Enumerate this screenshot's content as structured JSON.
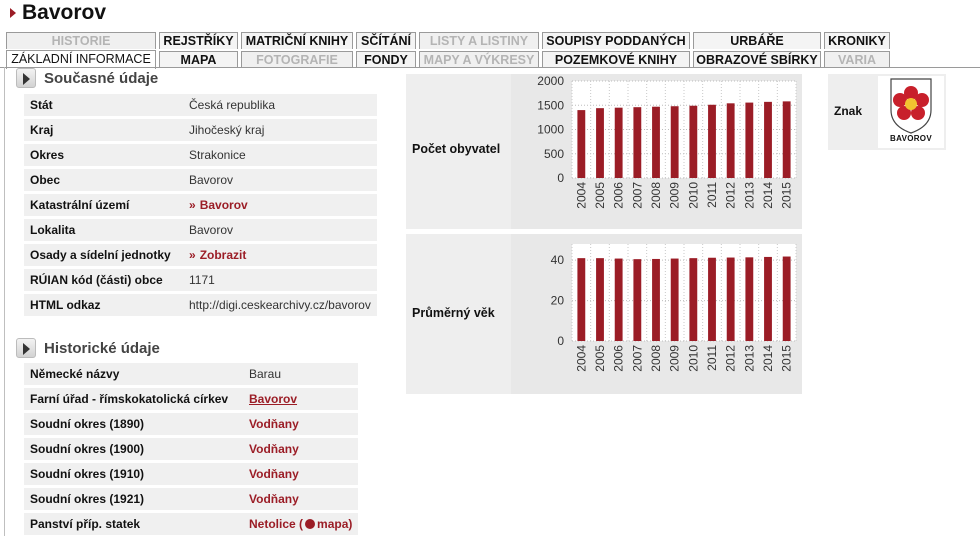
{
  "page": {
    "title": "Bavorov"
  },
  "tabs": {
    "row1": [
      {
        "label": "HISTORIE",
        "disabled": true
      },
      {
        "label": "REJSTŘÍKY",
        "disabled": false
      },
      {
        "label": "MATRIČNÍ KNIHY",
        "disabled": false
      },
      {
        "label": "SČÍTÁNÍ",
        "disabled": false
      },
      {
        "label": "LISTY A LISTINY",
        "disabled": true
      },
      {
        "label": "SOUPISY PODDANÝCH",
        "disabled": false
      },
      {
        "label": "URBÁŘE",
        "disabled": false
      },
      {
        "label": "KRONIKY",
        "disabled": false
      }
    ],
    "row2": [
      {
        "label": "ZÁKLADNÍ INFORMACE",
        "active": true
      },
      {
        "label": "MAPA",
        "disabled": false
      },
      {
        "label": "FOTOGRAFIE",
        "disabled": true
      },
      {
        "label": "FONDY",
        "disabled": false
      },
      {
        "label": "MAPY A VÝKRESY",
        "disabled": true
      },
      {
        "label": "POZEMKOVÉ KNIHY",
        "disabled": false
      },
      {
        "label": "OBRAZOVÉ SBÍRKY",
        "disabled": false
      },
      {
        "label": "VARIA",
        "disabled": true
      }
    ]
  },
  "current": {
    "heading": "Současné údaje",
    "rows": [
      {
        "key": "Stát",
        "value": "Česká republika"
      },
      {
        "key": "Kraj",
        "value": "Jihočeský kraj"
      },
      {
        "key": "Okres",
        "value": "Strakonice"
      },
      {
        "key": "Obec",
        "value": "Bavorov"
      },
      {
        "key": "Katastrální území",
        "value": "Bavorov",
        "link": true
      },
      {
        "key": "Lokalita",
        "value": "Bavorov"
      },
      {
        "key": "Osady a sídelní jednotky",
        "value": "Zobrazit",
        "link": true
      },
      {
        "key": "RÚIAN kód (části) obce",
        "value": "1171"
      },
      {
        "key": "HTML odkaz",
        "value": "http://digi.ceskearchivy.cz/bavorov"
      }
    ]
  },
  "historical": {
    "heading": "Historické údaje",
    "rows": [
      {
        "key": "Německé názvy",
        "value": "Barau"
      },
      {
        "key": "Farní úřad - římskokatolická církev",
        "value": "Bavorov",
        "style": "underline"
      },
      {
        "key": "Soudní okres (1890)",
        "value": "Vodňany",
        "style": "link"
      },
      {
        "key": "Soudní okres (1900)",
        "value": "Vodňany",
        "style": "link"
      },
      {
        "key": "Soudní okres (1910)",
        "value": "Vodňany",
        "style": "link"
      },
      {
        "key": "Soudní okres (1921)",
        "value": "Vodňany",
        "style": "link"
      },
      {
        "key": "Panství příp. statek",
        "value": "Netolice",
        "map_prefix": "(",
        "map_label": "mapa",
        "map_suffix": ")",
        "style": "link"
      }
    ]
  },
  "znak": {
    "label": "Znak",
    "caption": "BAVOROV",
    "icon": "coat-of-arms-icon"
  },
  "colors": {
    "bar": "#9b1d26",
    "accent": "#9b1d26"
  },
  "chart_data": [
    {
      "type": "bar",
      "title": "Počet obyvatel",
      "categories": [
        "2004",
        "2005",
        "2006",
        "2007",
        "2008",
        "2009",
        "2010",
        "2011",
        "2012",
        "2013",
        "2014",
        "2015"
      ],
      "values": [
        1400,
        1440,
        1450,
        1460,
        1470,
        1480,
        1490,
        1510,
        1540,
        1555,
        1570,
        1580
      ],
      "ylim": [
        0,
        2000
      ],
      "yticks": [
        "0",
        "500",
        "1000",
        "1500",
        "2000"
      ],
      "ytick_values": [
        0,
        500,
        1000,
        1500,
        2000
      ],
      "grid": true
    },
    {
      "type": "bar",
      "title": "Průměrný věk",
      "categories": [
        "2004",
        "2005",
        "2006",
        "2007",
        "2008",
        "2009",
        "2010",
        "2011",
        "2012",
        "2013",
        "2014",
        "2015"
      ],
      "values": [
        41,
        41,
        40.8,
        40.5,
        40.6,
        40.8,
        41,
        41.2,
        41.3,
        41.4,
        41.6,
        41.8
      ],
      "ylim": [
        0,
        48
      ],
      "yticks": [
        "0",
        "20",
        "40"
      ],
      "ytick_values": [
        0,
        20,
        40
      ],
      "grid": true
    }
  ]
}
